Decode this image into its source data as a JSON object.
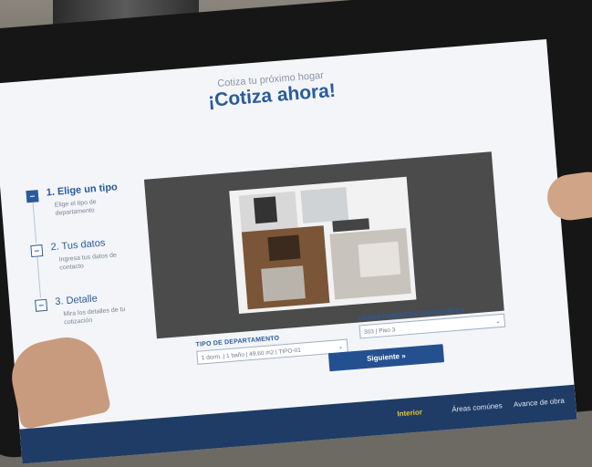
{
  "header": {
    "subtitle": "Cotiza tu próximo hogar",
    "title": "¡Cotiza ahora!"
  },
  "steps": [
    {
      "title": "1. Elige un tipo",
      "desc": "Elige el tipo de departamento",
      "active": true
    },
    {
      "title": "2. Tus datos",
      "desc": "Ingresa tus datos de contacto",
      "active": false
    },
    {
      "title": "3. Detalle",
      "desc": "Mira los detalles de tu cotización",
      "active": false
    }
  ],
  "form": {
    "tipo_label": "TIPO DE DEPARTAMENTO",
    "tipo_value": "1 dorm. | 1 baño | 49,60 m2 | TIPO-01",
    "disponibles_label": "DEPARTAMENTOS DISPONIBLES",
    "disponibles_value": "303 | Piso 3",
    "submit_label": "Siguiente »"
  },
  "nav": {
    "items": [
      "Interior",
      "Áreas comúnes",
      "Avance de obra"
    ],
    "active": "Interior"
  },
  "colors": {
    "primary": "#2a5a9b",
    "button": "#25508f",
    "nav_bg": "#1f3c66",
    "nav_active": "#f0c52a"
  }
}
